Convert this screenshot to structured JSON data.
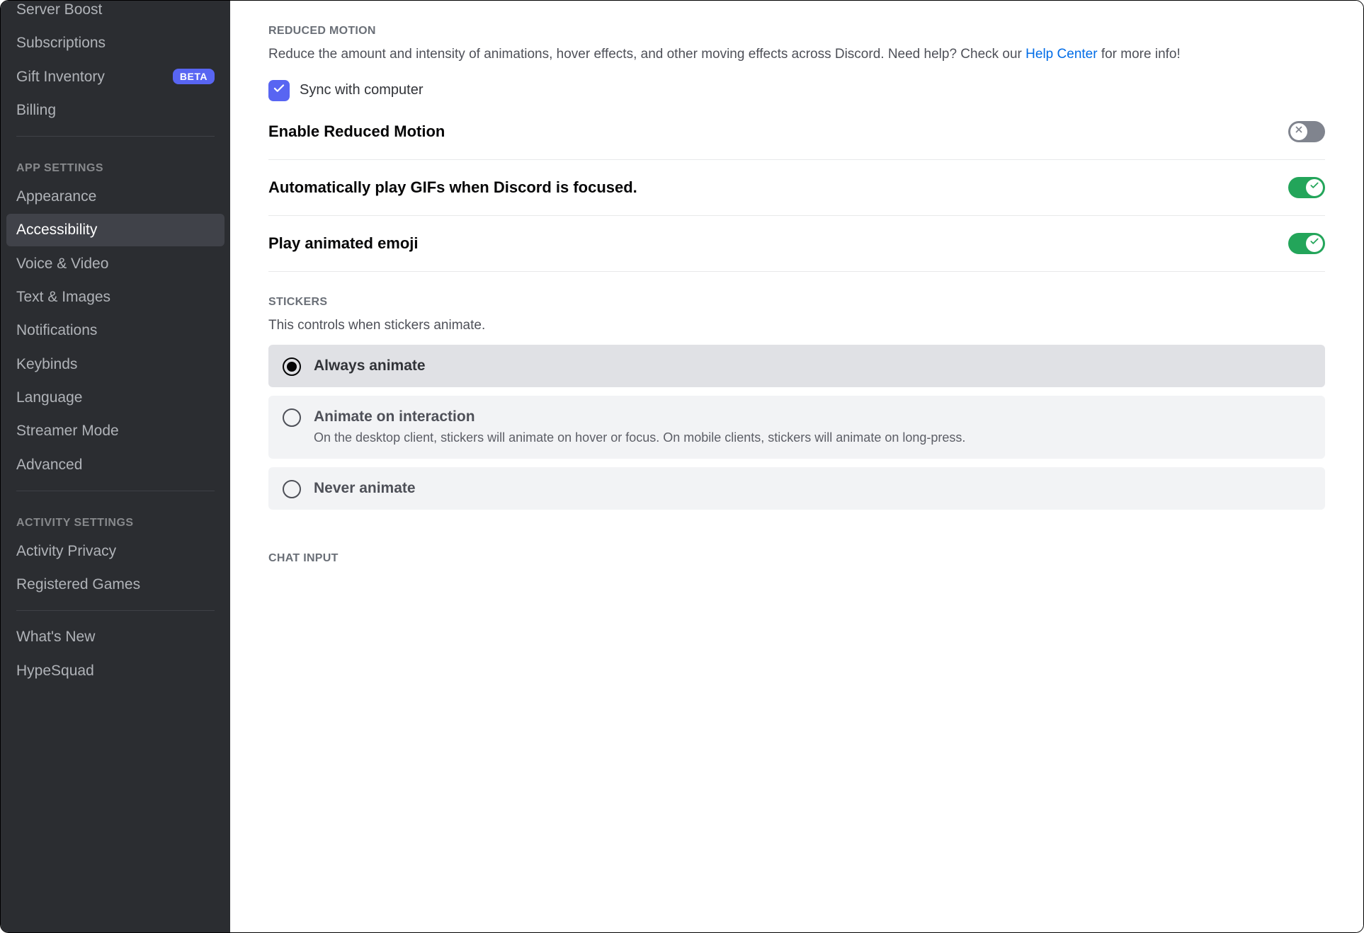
{
  "sidebar": {
    "items_top": [
      {
        "label": "Server Boost"
      },
      {
        "label": "Subscriptions"
      },
      {
        "label": "Gift Inventory",
        "badge": "BETA"
      },
      {
        "label": "Billing"
      }
    ],
    "app_header": "APP SETTINGS",
    "items_app": [
      {
        "label": "Appearance"
      },
      {
        "label": "Accessibility",
        "active": true
      },
      {
        "label": "Voice & Video"
      },
      {
        "label": "Text & Images"
      },
      {
        "label": "Notifications"
      },
      {
        "label": "Keybinds"
      },
      {
        "label": "Language"
      },
      {
        "label": "Streamer Mode"
      },
      {
        "label": "Advanced"
      }
    ],
    "activity_header": "ACTIVITY SETTINGS",
    "items_activity": [
      {
        "label": "Activity Privacy"
      },
      {
        "label": "Registered Games"
      }
    ],
    "items_bottom": [
      {
        "label": "What's New"
      },
      {
        "label": "HypeSquad"
      }
    ]
  },
  "reduced_motion": {
    "title": "REDUCED MOTION",
    "desc_pre": "Reduce the amount and intensity of animations, hover effects, and other moving effects across Discord. Need help? Check our ",
    "link": "Help Center",
    "desc_post": " for more info!",
    "sync_label": "Sync with computer",
    "toggle1": {
      "label": "Enable Reduced Motion",
      "on": false
    },
    "toggle2": {
      "label": "Automatically play GIFs when Discord is focused.",
      "on": true
    },
    "toggle3": {
      "label": "Play animated emoji",
      "on": true
    }
  },
  "stickers": {
    "title": "STICKERS",
    "desc": "This controls when stickers animate.",
    "options": [
      {
        "title": "Always animate",
        "selected": true
      },
      {
        "title": "Animate on interaction",
        "sub": "On the desktop client, stickers will animate on hover or focus. On mobile clients, stickers will animate on long-press."
      },
      {
        "title": "Never animate"
      }
    ]
  },
  "chat_input": {
    "title": "CHAT INPUT"
  }
}
